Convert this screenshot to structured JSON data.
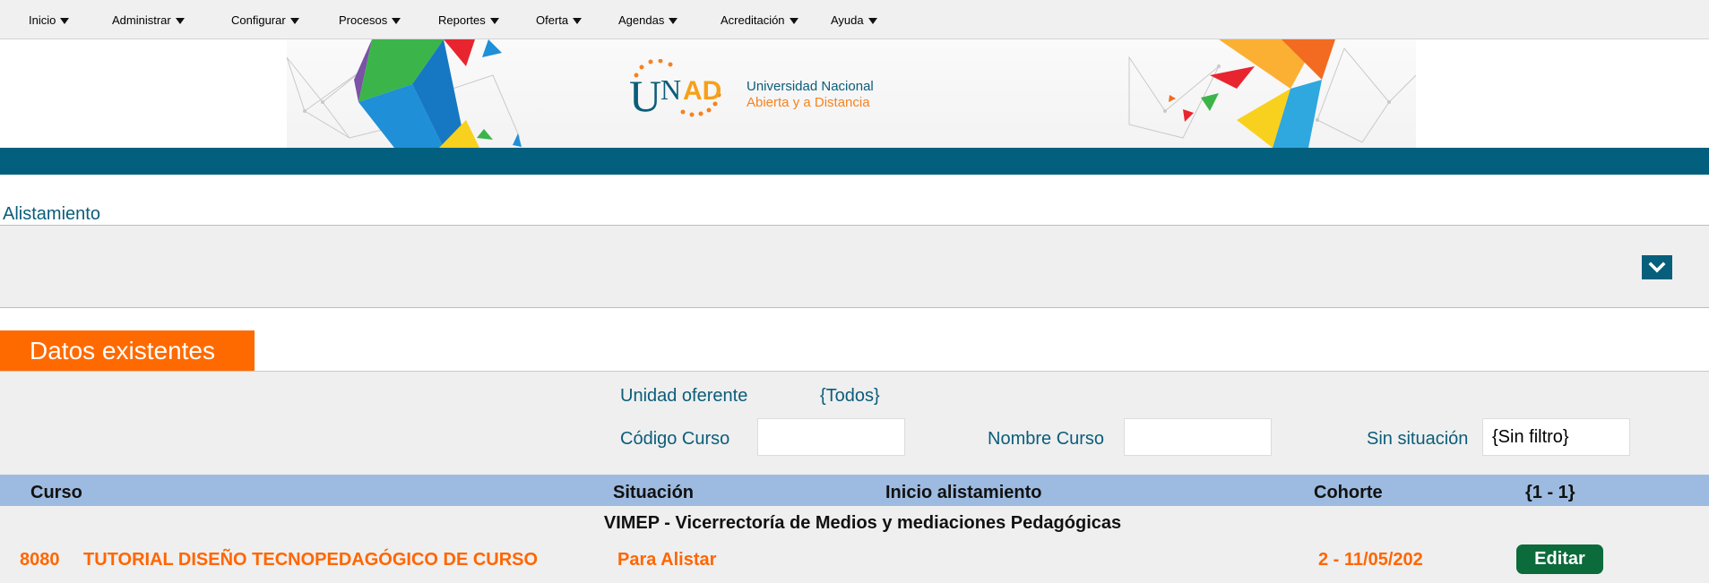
{
  "menu": {
    "items": [
      {
        "label": "Inicio"
      },
      {
        "label": "Administrar"
      },
      {
        "label": "Configurar"
      },
      {
        "label": "Procesos"
      },
      {
        "label": "Reportes"
      },
      {
        "label": "Oferta"
      },
      {
        "label": "Agendas"
      },
      {
        "label": "Acreditación"
      },
      {
        "label": "Ayuda"
      }
    ]
  },
  "banner": {
    "logo_mark": "UNAD",
    "university_line1": "Universidad Nacional",
    "university_line2": "Abierta y a Distancia"
  },
  "section": {
    "title": "Alistamiento"
  },
  "results": {
    "tab_label": "Datos existentes",
    "filters": {
      "unidad_label": "Unidad oferente",
      "unidad_value": "{Todos}",
      "codigo_label": "Código Curso",
      "codigo_value": "",
      "nombre_label": "Nombre Curso",
      "nombre_value": "",
      "situacion_label": "Sin situación",
      "situacion_value": "{Sin filtro}"
    },
    "columns": {
      "curso": "Curso",
      "situacion": "Situación",
      "inicio": "Inicio alistamiento",
      "cohorte": "Cohorte",
      "range": "{1 - 1}"
    },
    "group": "VIMEP - Vicerrectoría de Medios y mediaciones Pedagógicas",
    "rows": [
      {
        "code": "8080",
        "name": "TUTORIAL DISEÑO TECNOPEDAGÓGICO DE CURSO",
        "situacion": "Para Alistar",
        "cohorte": "2 - 11/05/202",
        "action": "Editar"
      }
    ]
  },
  "colors": {
    "teal": "#02607e",
    "orange": "#ff6a00",
    "table_header": "#9dbbe0",
    "edit_button": "#0b6b3a"
  }
}
